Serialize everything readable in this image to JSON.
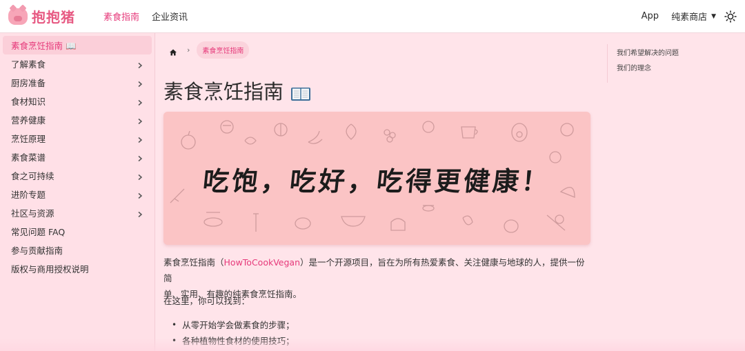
{
  "header": {
    "brand": "抱抱猪",
    "nav": [
      "素食指南",
      "企业资讯"
    ],
    "app": "App",
    "shop": "纯素商店"
  },
  "sidebar": {
    "items": [
      {
        "label": "素食烹饪指南 📖",
        "active": true,
        "chevron": false
      },
      {
        "label": "了解素食",
        "chevron": true
      },
      {
        "label": "厨房准备",
        "chevron": true
      },
      {
        "label": "食材知识",
        "chevron": true
      },
      {
        "label": "营养健康",
        "chevron": true
      },
      {
        "label": "烹饪原理",
        "chevron": true
      },
      {
        "label": "素食菜谱",
        "chevron": true
      },
      {
        "label": "食之可持续",
        "chevron": true
      },
      {
        "label": "进阶专题",
        "chevron": true
      },
      {
        "label": "社区与资源",
        "chevron": true
      },
      {
        "label": "常见问题 FAQ",
        "chevron": false
      },
      {
        "label": "参与贡献指南",
        "chevron": false
      },
      {
        "label": "版权与商用授权说明",
        "chevron": false
      }
    ]
  },
  "breadcrumb": {
    "current": "素食烹饪指南"
  },
  "main": {
    "title": "素食烹饪指南",
    "banner_text": "吃饱，吃好，吃得更健康！",
    "intro_prefix": "素食烹饪指南（",
    "intro_link": "HowToCookVegan",
    "intro_suffix": "）是一个开源项目，旨在为所有热爱素食、关注健康与地球的人，提供一份简",
    "intro_line2": "单、实用、有趣的纯素食烹饪指南。",
    "here_text": "在这里，你可以找到：",
    "bullets": [
      "从零开始学会做素食的步骤；",
      "各种植物性食材的使用技巧；"
    ]
  },
  "toc": [
    "我们希望解决的问题",
    "我们的理念"
  ],
  "colors": {
    "accent": "#e6397a",
    "background": "#ffe4ea",
    "banner": "#fbc4c5"
  }
}
